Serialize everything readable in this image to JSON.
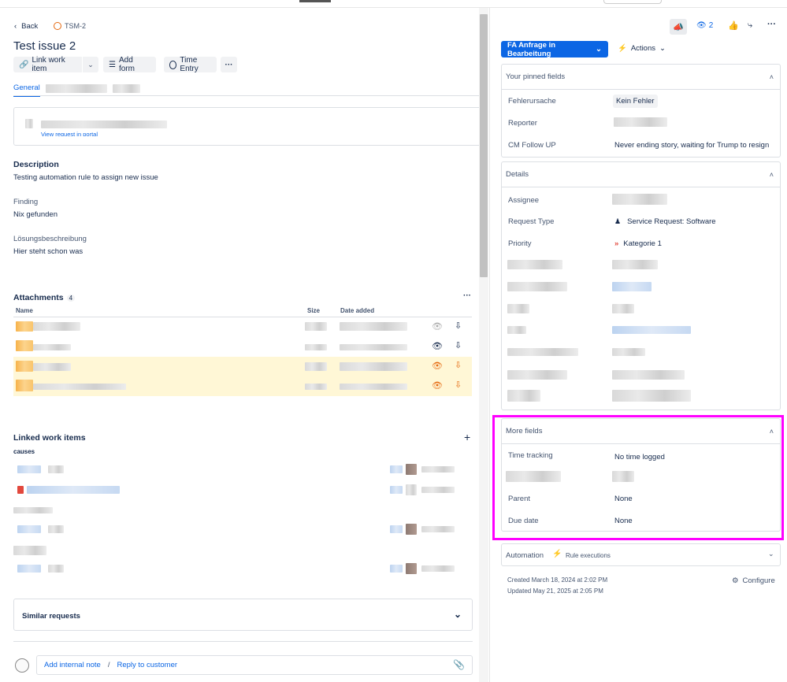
{
  "header": {
    "back_label": "Back",
    "issue_key": "TSM-2",
    "title": "Test issue 2"
  },
  "toolbar": {
    "link_work_item": "Link work item",
    "add_form": "Add form",
    "time_entry": "Time Entry"
  },
  "tabs": {
    "general": "General"
  },
  "request_card": {
    "view_request": "View request in portal"
  },
  "description": {
    "heading": "Description",
    "text": "Testing automation rule to assign new issue"
  },
  "finding": {
    "label": "Finding",
    "value": "Nix gefunden"
  },
  "loesung": {
    "label": "Lösungsbeschreibung",
    "value": "Hier steht schon was"
  },
  "attachments": {
    "heading": "Attachments",
    "count": "4",
    "col_name": "Name",
    "col_size": "Size",
    "col_date": "Date added"
  },
  "linked": {
    "heading": "Linked work items",
    "relation": "causes"
  },
  "similar": {
    "heading": "Similar requests"
  },
  "comment": {
    "add_internal_note": "Add internal note",
    "separator": "/",
    "reply_to_customer": "Reply to customer"
  },
  "right_header": {
    "watch_count": "2"
  },
  "status": {
    "label": "FA Anfrage in Bearbeitung",
    "color": "#0c66e4"
  },
  "actions": {
    "label": "Actions"
  },
  "pinned": {
    "heading": "Your pinned fields",
    "fields": [
      {
        "label": "Fehlerursache",
        "value": "Kein Fehler"
      },
      {
        "label": "Reporter",
        "value": ""
      },
      {
        "label": "CM Follow UP",
        "value": "Never ending story, waiting for Trump to resign"
      }
    ]
  },
  "details": {
    "heading": "Details",
    "assignee_label": "Assignee",
    "request_type_label": "Request Type",
    "request_type_value": "Service Request: Software",
    "priority_label": "Priority",
    "priority_value": "Kategorie 1",
    "priority_color": "#e2483d"
  },
  "more_fields": {
    "heading": "More fields",
    "time_tracking_label": "Time tracking",
    "time_tracking_value": "No time logged",
    "parent_label": "Parent",
    "parent_value": "None",
    "due_date_label": "Due date",
    "due_date_value": "None",
    "highlight_color": "#ff00ff"
  },
  "automation": {
    "heading": "Automation",
    "rule_executions": "Rule executions"
  },
  "meta": {
    "created": "Created March 18, 2024 at 2:02 PM",
    "updated": "Updated May 21, 2025 at 2:05 PM",
    "configure": "Configure"
  }
}
